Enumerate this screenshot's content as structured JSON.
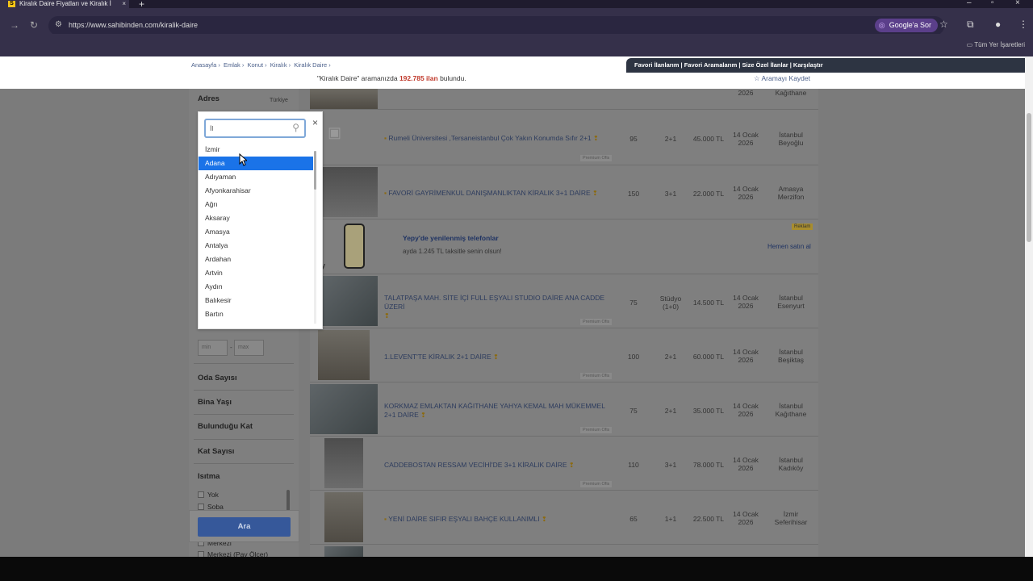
{
  "browser": {
    "tab_title": "Kiralık Daire Fiyatları ve Kiralık İ",
    "tab_favicon": "S",
    "new_tab": "+",
    "url": "https://www.sahibinden.com/kiralik-daire",
    "google_button": "Google'a Sor",
    "bookmarks_label": "Tüm Yer İşaretleri"
  },
  "header": {
    "breadcrumbs": [
      "Anasayfa ›",
      "Emlak ›",
      "Konut ›",
      "Kiralık ›",
      "Kiralık Daire ›"
    ],
    "quicklinks": "Favori İlanlarım  |  Favori Aramalarım  |  Size Özel İlanlar  |  Karşılaştır",
    "result_pre": "\"Kiralık Daire\" aramanızda",
    "result_count": "192.785 ilan",
    "result_post": "bulundu.",
    "save_search": "☆ Aramayı Kaydet"
  },
  "sidebar": {
    "address_heading": "Adres",
    "address_country": "Türkiye",
    "min_placeholder": "min",
    "max_placeholder": "max",
    "dash": "-",
    "oda": "Oda Sayısı",
    "bina": "Bina Yaşı",
    "kat": "Bulunduğu Kat",
    "katsayisi": "Kat Sayısı",
    "isitma": "Isıtma",
    "heat_options": [
      "Yok",
      "Soba",
      "Merkezi",
      "Merkezi (Pay Ölçer)"
    ],
    "search_button": "Ara"
  },
  "dropdown": {
    "input_value": "İl",
    "close": "×",
    "options": [
      "İzmir",
      "Adana",
      "Adıyaman",
      "Afyonkarahisar",
      "Ağrı",
      "Aksaray",
      "Amasya",
      "Antalya",
      "Ardahan",
      "Artvin",
      "Aydın",
      "Balıkesir",
      "Bartın"
    ],
    "selected": "Adana"
  },
  "listings": [
    {
      "title": "Rumeli Üniversitesi ,Tersaneistanbul Çok Yakın Konumda Sıfır 2+1",
      "m2": "95",
      "rooms": "2+1",
      "price": "45.000 TL",
      "date1": "14 Ocak",
      "date2": "2026",
      "loc1": "İstanbul",
      "loc2": "Beyoğlu",
      "premium": "Premium Ofis"
    },
    {
      "title": "FAVORİ GAYRİMENKUL DANIŞMANLIKTAN KİRALIK 3+1 DAİRE",
      "m2": "150",
      "rooms": "3+1",
      "price": "22.000 TL",
      "date1": "14 Ocak",
      "date2": "2026",
      "loc1": "Amasya",
      "loc2": "Merzifon"
    },
    {
      "title": "TALATPAŞA MAH. SİTE İÇİ FULL EŞYALI STUDIO DAİRE ANA CADDE ÜZERİ",
      "m2": "75",
      "rooms": "Stüdyo (1+0)",
      "price": "14.500 TL",
      "date1": "14 Ocak",
      "date2": "2026",
      "loc1": "İstanbul",
      "loc2": "Esenyurt",
      "premium": "Premium Ofis"
    },
    {
      "title": "1.LEVENT'TE KİRALIK 2+1 DAİRE",
      "m2": "100",
      "rooms": "2+1",
      "price": "60.000 TL",
      "date1": "14 Ocak",
      "date2": "2026",
      "loc1": "İstanbul",
      "loc2": "Beşiktaş",
      "premium": "Premium Ofis"
    },
    {
      "title": "KORKMAZ EMLAKTAN KAĞITHANE YAHYA KEMAL MAH MÜKEMMEL 2+1 DAİRE",
      "m2": "75",
      "rooms": "2+1",
      "price": "35.000 TL",
      "date1": "14 Ocak",
      "date2": "2026",
      "loc1": "İstanbul",
      "loc2": "Kağıthane",
      "premium": "Premium Ofis"
    },
    {
      "title": "CADDEBOSTAN RESSAM VECİHİ'DE 3+1 KİRALIK DAİRE",
      "m2": "110",
      "rooms": "3+1",
      "price": "78.000 TL",
      "date1": "14 Ocak",
      "date2": "2026",
      "loc1": "İstanbul",
      "loc2": "Kadıköy",
      "premium": "Premium Ofis"
    },
    {
      "title": "YENİ DAİRE SIFIR EŞYALI BAHÇE KULLANIMLI",
      "m2": "65",
      "rooms": "1+1",
      "price": "22.500 TL",
      "date1": "14 Ocak",
      "date2": "2026",
      "loc1": "İzmir",
      "loc2": "Seferihisar"
    }
  ],
  "top_row": {
    "date": "2026",
    "loc": "Kağıthane"
  },
  "ad": {
    "title": "Yepy'de yenilenmiş telefonlar",
    "subtitle": "ayda 1.245 TL taksitle senin olsun!",
    "cta": "Hemen satın al",
    "badge": "Reklam",
    "brand": "y"
  }
}
